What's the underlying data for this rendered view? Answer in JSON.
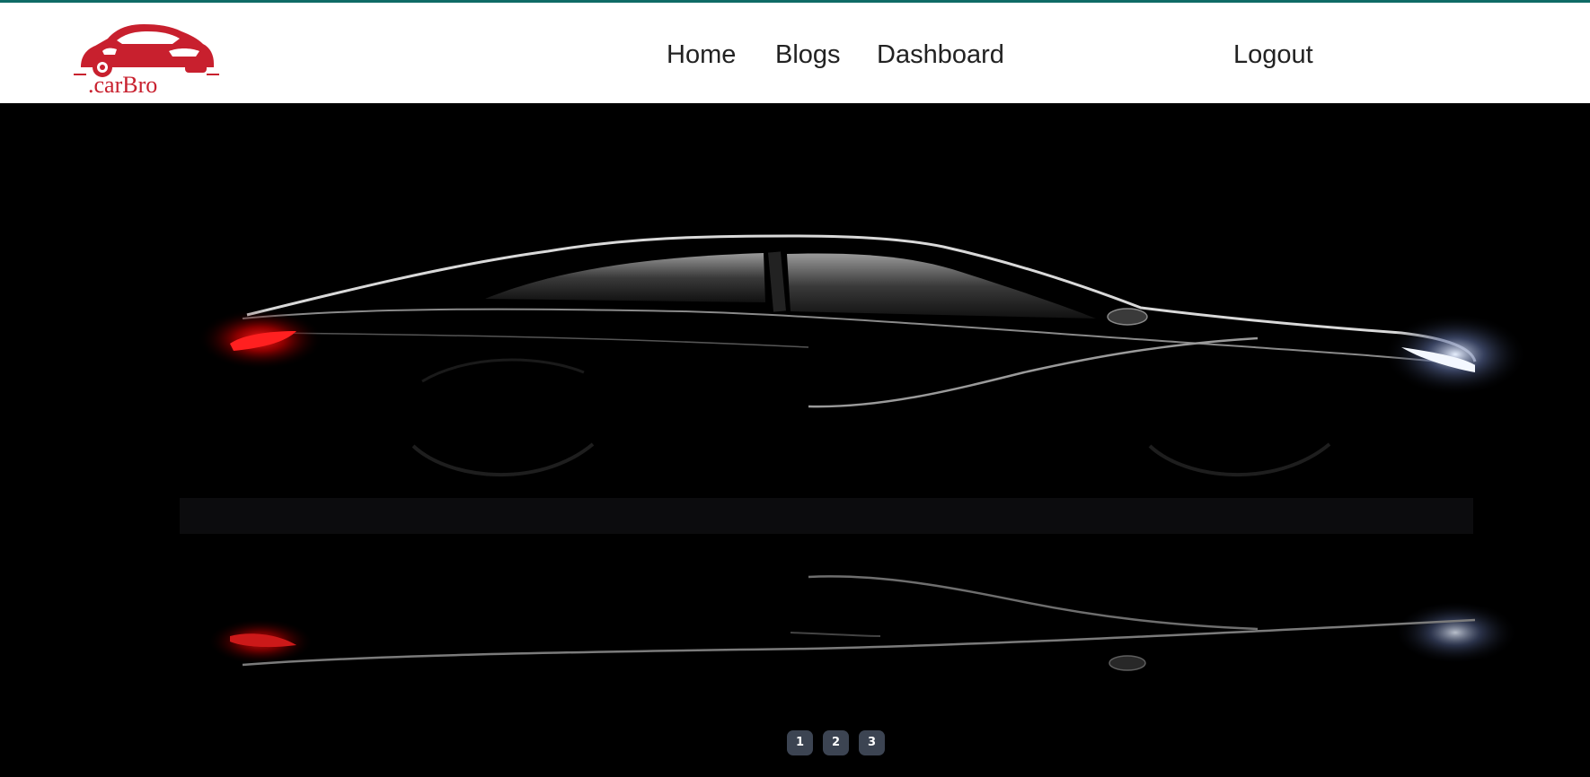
{
  "brand": {
    "logo_text": ".carBro",
    "logo_color": "#c8202e"
  },
  "nav": {
    "items": [
      {
        "label": "Home"
      },
      {
        "label": "Blogs"
      },
      {
        "label": "Dashboard"
      }
    ],
    "logout_label": "Logout"
  },
  "hero": {
    "image": "car-silhouette-dark"
  },
  "carousel": {
    "pages": [
      "1",
      "2",
      "3"
    ]
  },
  "colors": {
    "top_border": "#0f6b66",
    "hero_bg": "#000000",
    "pager_bg": "#3c4452"
  }
}
